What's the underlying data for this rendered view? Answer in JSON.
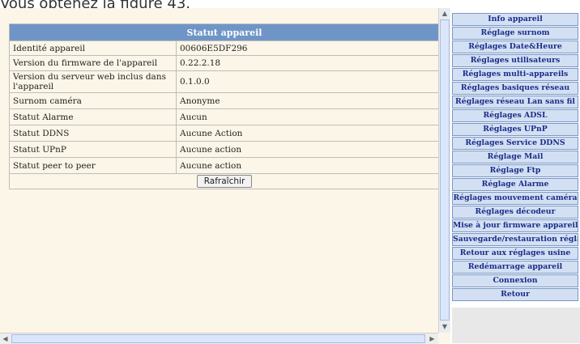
{
  "caption": "Vous obtenez la figure 43.",
  "status_panel": {
    "title": "Statut appareil",
    "rows": [
      {
        "label": "Identité appareil",
        "value": "00606E5DF296"
      },
      {
        "label": "Version du firmware de l'appareil",
        "value": "0.22.2.18"
      },
      {
        "label": "Version du serveur web inclus dans l'appareil",
        "value": "0.1.0.0"
      },
      {
        "label": "Surnom caméra",
        "value": "Anonyme"
      },
      {
        "label": "Statut Alarme",
        "value": "Aucun"
      },
      {
        "label": "Statut DDNS",
        "value": "Aucune Action"
      },
      {
        "label": "Statut UPnP",
        "value": "Aucune action"
      },
      {
        "label": "Statut peer to peer",
        "value": "Aucune action"
      }
    ],
    "refresh_label": "Rafraîchir"
  },
  "menu": [
    "Info appareil",
    "Réglage surnom",
    "Réglages Date&Heure",
    "Réglages utilisateurs",
    "Réglages multi-appareils",
    "Réglages basiques réseau",
    "Réglages réseau Lan sans fil",
    "Réglages ADSL",
    "Réglages UPnP",
    "Réglages Service DDNS",
    "Réglage Mail",
    "Réglage Ftp",
    "Réglage Alarme",
    "Réglages mouvement caméra",
    "Réglages décodeur",
    "Mise à jour firmware appareil",
    "Sauvegarde/restauration réglages",
    "Retour aux réglages usine",
    "Redémarrage appareil",
    "Connexion",
    "Retour"
  ]
}
